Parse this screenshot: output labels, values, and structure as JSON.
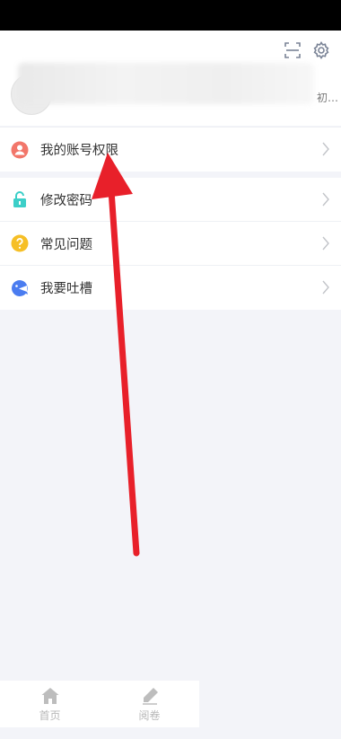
{
  "profile": {
    "tag": "初…"
  },
  "header": {
    "icons": [
      "scan-icon",
      "settings-gear-icon"
    ]
  },
  "menu_group_1": [
    {
      "label": "我的账号权限",
      "icon": "user-circle-icon",
      "color": "#f2766a"
    }
  ],
  "menu_group_2": [
    {
      "label": "修改密码",
      "icon": "lock-icon",
      "color": "#3ccfc8"
    },
    {
      "label": "常见问题",
      "icon": "question-circle-icon",
      "color": "#f6bf26"
    },
    {
      "label": "我要吐槽",
      "icon": "chat-bubble-icon",
      "color": "#4a7cf0"
    }
  ],
  "tabbar": {
    "items": [
      {
        "label": "首页",
        "icon": "home-icon"
      },
      {
        "label": "阅卷",
        "icon": "pencil-icon"
      }
    ]
  },
  "annotation": {
    "color": "#e8202a"
  }
}
